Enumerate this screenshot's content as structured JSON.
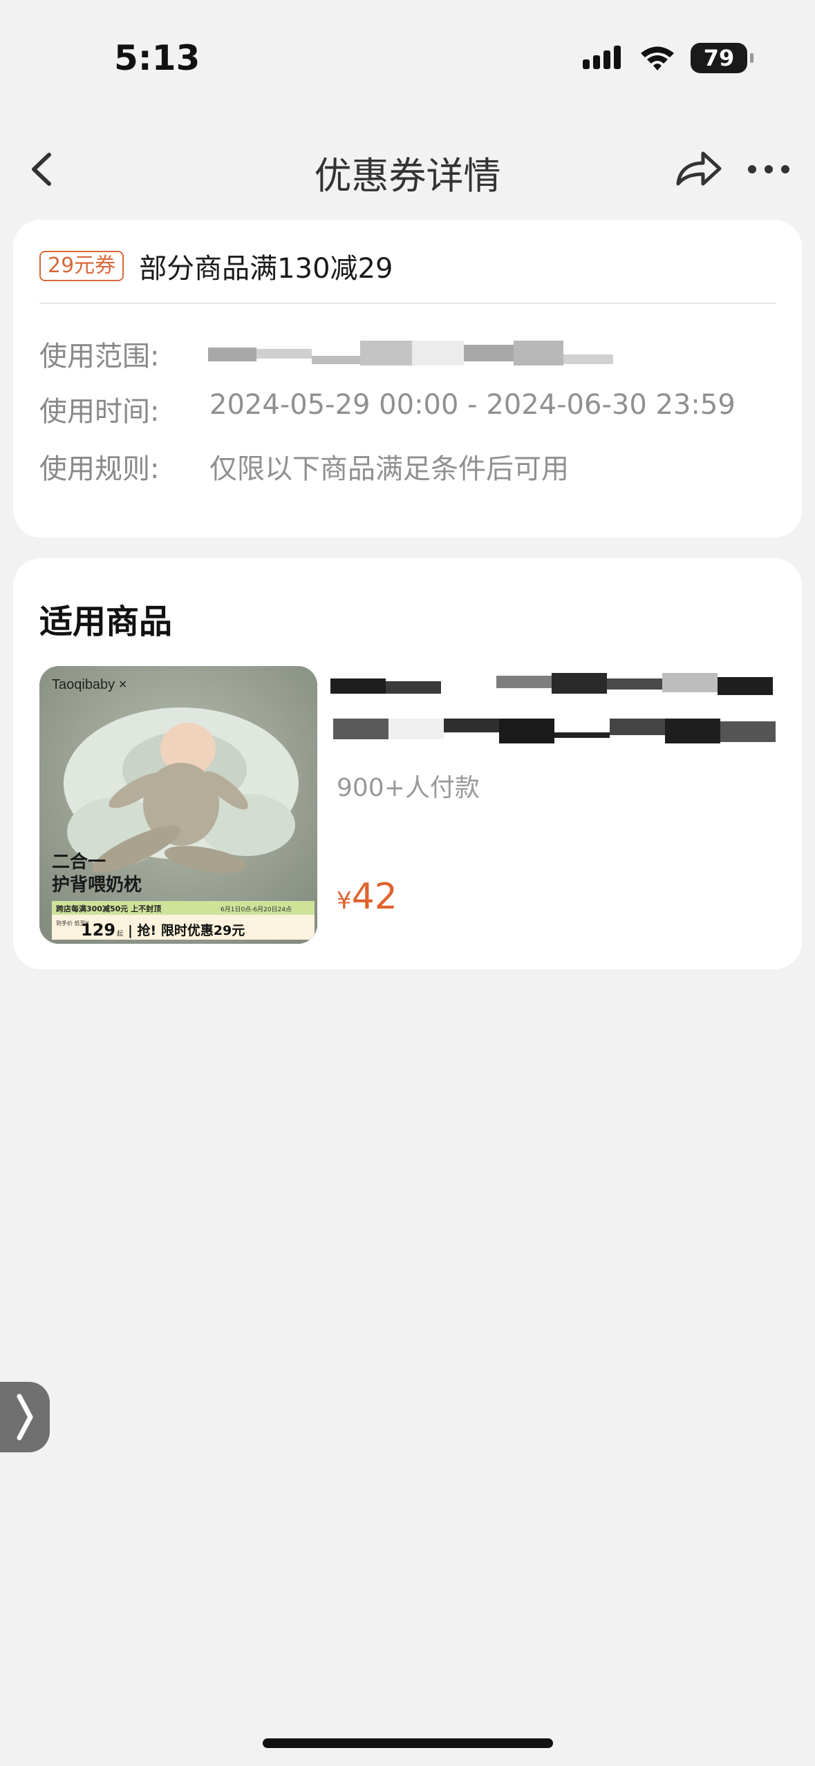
{
  "status_bar": {
    "time": "5:13",
    "battery_level": "79",
    "signal_icon": "cellular-signal-icon",
    "wifi_icon": "wifi-icon"
  },
  "nav": {
    "title": "优惠券详情",
    "back_icon": "chevron-left-icon",
    "share_icon": "share-icon",
    "more_icon": "more-icon"
  },
  "coupon": {
    "badge": "29元券",
    "name": "部分商品满130减29",
    "rows": [
      {
        "label": "使用范围:",
        "value": ""
      },
      {
        "label": "使用时间:",
        "value": "2024-05-29 00:00 - 2024-06-30 23:59"
      },
      {
        "label": "使用规则:",
        "value": "仅限以下商品满足条件后可用"
      }
    ]
  },
  "products": {
    "title": "适用商品",
    "items": [
      {
        "image_texts": {
          "brand": "Taoqibaby ×",
          "headline_1": "二合一",
          "headline_2": "护背喂奶枕",
          "promo": "跨店每满300减50元 上不封顶",
          "dates": "6月1日0点-6月20日24点",
          "price_label": "到手价 低至¥",
          "price": "129",
          "unit": "起",
          "cta": "| 抢!  限时优惠29元"
        },
        "sold": "900+人付款",
        "price_symbol": "¥",
        "price": "42"
      }
    ]
  },
  "colors": {
    "accent": "#e0622d",
    "background": "#f2f2f2",
    "card": "#ffffff"
  }
}
